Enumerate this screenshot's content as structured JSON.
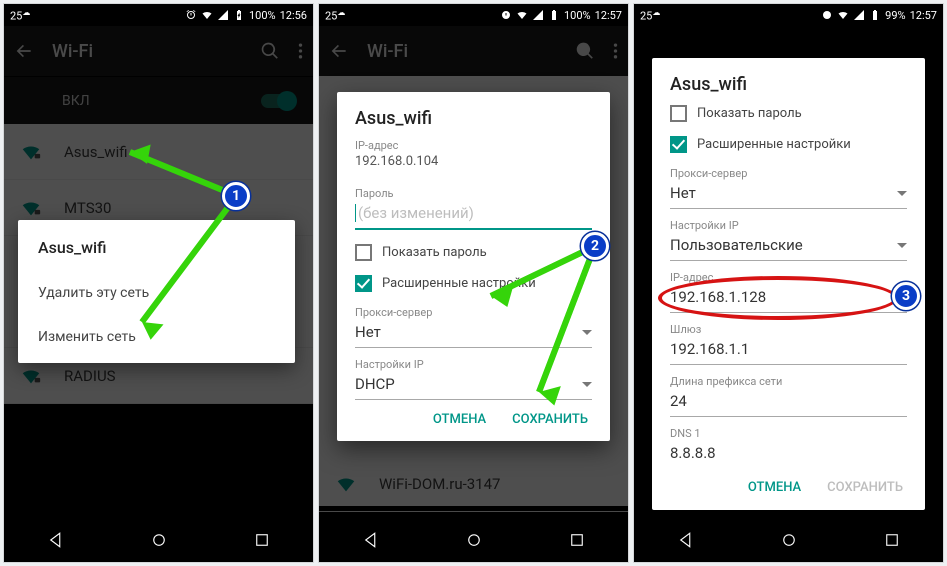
{
  "status": {
    "temp": "25",
    "battery1": "100%",
    "time1": "12:56",
    "battery2": "100%",
    "time2": "12:57",
    "battery3": "99%",
    "time3": "12:57"
  },
  "appbar": {
    "title": "Wi-Fi"
  },
  "toggle": {
    "label": "ВКЛ"
  },
  "networks": [
    {
      "name": "Asus_wifi"
    },
    {
      "name": "MTS30"
    },
    {
      "name": "RADIUS"
    },
    {
      "name": "WiFi-DOM.ru-3147"
    }
  ],
  "ctx": {
    "title": "Asus_wifi",
    "forget": "Удалить эту сеть",
    "modify": "Изменить сеть"
  },
  "dlg2": {
    "title": "Asus_wifi",
    "ip_label": "IP-адрес",
    "ip_value": "192.168.0.104",
    "pass_label": "Пароль",
    "pass_placeholder": "(без изменений)",
    "show_password": "Показать пароль",
    "advanced": "Расширенные настройки",
    "proxy_label": "Прокси-сервер",
    "proxy_value": "Нет",
    "ipset_label": "Настройки IP",
    "ipset_value": "DHCP",
    "cancel": "ОТМЕНА",
    "save": "СОХРАНИТЬ"
  },
  "dlg3": {
    "title": "Asus_wifi",
    "show_password": "Показать пароль",
    "advanced": "Расширенные настройки",
    "proxy_label": "Прокси-сервер",
    "proxy_value": "Нет",
    "ipset_label": "Настройки IP",
    "ipset_value": "Пользовательские",
    "ip_label": "IP-адрес",
    "ip_value": "192.168.1.128",
    "gw_label": "Шлюз",
    "gw_value": "192.168.1.1",
    "prefix_label": "Длина префикса сети",
    "prefix_value": "24",
    "dns_label": "DNS 1",
    "dns_value": "8.8.8.8",
    "cancel": "ОТМЕНА",
    "save": "СОХРАНИТЬ"
  },
  "badges": {
    "b1": "1",
    "b2": "2",
    "b3": "3"
  }
}
